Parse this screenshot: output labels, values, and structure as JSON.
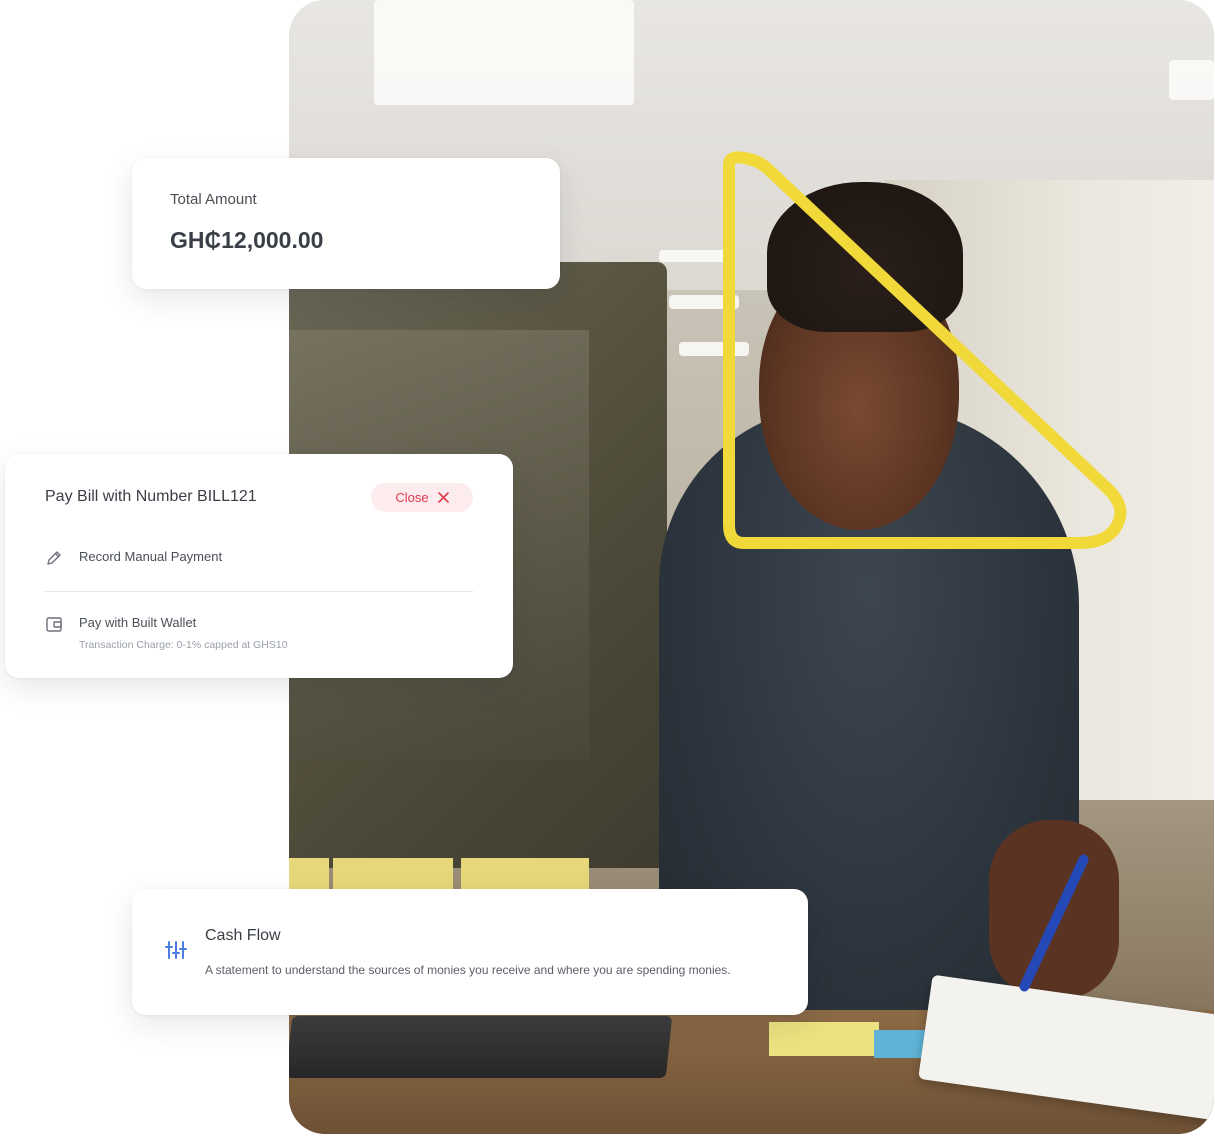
{
  "total_card": {
    "label": "Total Amount",
    "amount": "GH₵12,000.00"
  },
  "pay_card": {
    "title": "Pay Bill with Number BILL121",
    "close_label": "Close",
    "options": [
      {
        "icon": "pencil-icon",
        "label": "Record Manual Payment"
      },
      {
        "icon": "wallet-icon",
        "label": "Pay with Built Wallet",
        "sub": "Transaction Charge: 0-1% capped at GHS10"
      }
    ]
  },
  "cash_card": {
    "icon": "sliders-icon",
    "title": "Cash Flow",
    "description": "A statement to understand the sources of monies you receive and where you are spending monies."
  },
  "colors": {
    "accent_yellow": "#f2d93a",
    "close_red": "#e5394e",
    "close_bg": "#fdecee",
    "cash_icon_blue": "#4a7fe0"
  }
}
